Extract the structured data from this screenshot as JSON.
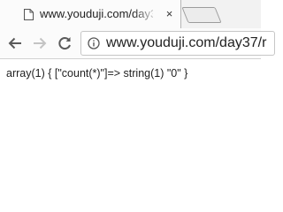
{
  "tab": {
    "title": "www.youduji.com/day3",
    "close_glyph": "×",
    "page_icon": "page-icon"
  },
  "toolbar": {
    "back_icon": "back-arrow-icon",
    "forward_icon": "forward-arrow-icon",
    "reload_icon": "reload-icon"
  },
  "omnibox": {
    "info_icon": "info-icon",
    "url": "www.youduji.com/day37/r"
  },
  "page": {
    "output": "array(1) { [\"count(*)\"]=> string(1) \"0\" }"
  }
}
